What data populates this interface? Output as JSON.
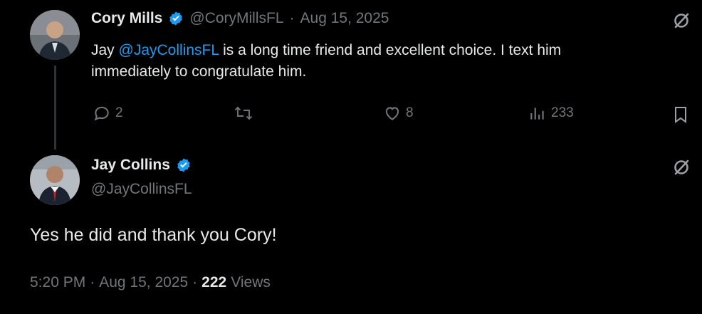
{
  "colors": {
    "background": "#000000",
    "text": "#e7e9ea",
    "muted": "#71767b",
    "link": "#1d9bf0",
    "verified": "#1d9bf0"
  },
  "parent_tweet": {
    "author_name": "Cory Mills",
    "handle": "@CoryMillsFL",
    "separator": "·",
    "date": "Aug 15, 2025",
    "text_prefix": "Jay ",
    "mention": "@JayCollinsFL",
    "text_line1_rest": " is a long time friend and excellent choice. I text him",
    "text_line2": "immediately to congratulate him.",
    "actions": {
      "reply_count": "2",
      "retweet_count": "",
      "like_count": "8",
      "views_count": "233"
    },
    "icons": [
      "reply-icon",
      "retweet-icon",
      "like-icon",
      "views-icon",
      "bookmark-icon",
      "grok-icon"
    ]
  },
  "reply_tweet": {
    "author_name": "Jay Collins",
    "handle": "@JayCollinsFL",
    "text": "Yes he did and thank you Cory!",
    "time": "5:20 PM",
    "date": "Aug 15, 2025",
    "views_count": "222",
    "views_label": "Views",
    "separator": "·",
    "icons": [
      "grok-icon"
    ]
  }
}
